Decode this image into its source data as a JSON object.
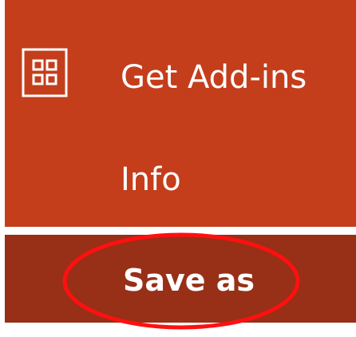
{
  "menu": {
    "items": [
      {
        "label": "Get Add-ins",
        "icon": "add-ins-grid-icon"
      },
      {
        "label": "Info"
      },
      {
        "label": "Save as",
        "highlighted": true
      }
    ]
  },
  "colors": {
    "menu_background": "#c43e1c",
    "selected_background": "#982f17",
    "text": "#ffffff",
    "annotation": "#ff1010"
  },
  "annotation": {
    "shape": "ellipse",
    "target": "Save as"
  }
}
